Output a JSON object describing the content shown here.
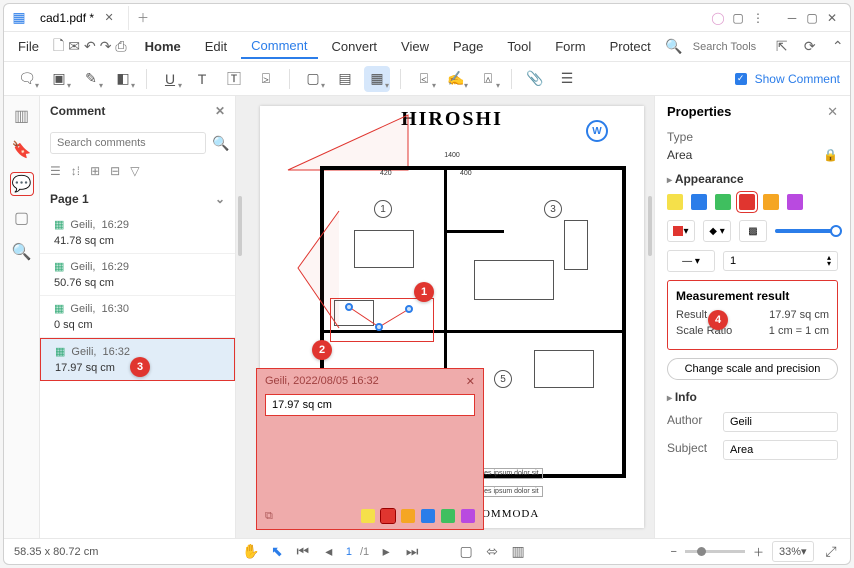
{
  "tab": {
    "title": "cad1.pdf *"
  },
  "menu": {
    "file": "File",
    "home": "Home",
    "edit": "Edit",
    "comment": "Comment",
    "convert": "Convert",
    "view": "View",
    "page": "Page",
    "tool": "Tool",
    "form": "Form",
    "protect": "Protect"
  },
  "search_tools_placeholder": "Search Tools",
  "show_comment": "Show Comment",
  "comment_panel": {
    "title": "Comment",
    "search_placeholder": "Search comments",
    "page_label": "Page 1",
    "items": [
      {
        "author": "Geili,",
        "time": "16:29",
        "value": "41.78 sq cm"
      },
      {
        "author": "Geili,",
        "time": "16:29",
        "value": "50.76 sq cm"
      },
      {
        "author": "Geili,",
        "time": "16:30",
        "value": "0 sq cm"
      },
      {
        "author": "Geili,",
        "time": "16:32",
        "value": "17.97 sq cm"
      }
    ]
  },
  "popup": {
    "meta": "Geili,   2022/08/05 16:32",
    "value": "17.97 sq cm"
  },
  "properties": {
    "title": "Properties",
    "type_label": "Type",
    "type_value": "Area",
    "appearance": "Appearance",
    "opacity_value": "1",
    "measurement_title": "Measurement result",
    "result_label": "Result",
    "result_value": "17.97 sq cm",
    "scale_label": "Scale Ratio",
    "scale_value": "1 cm = 1 cm",
    "change_btn": "Change scale and precision",
    "info": "Info",
    "author_label": "Author",
    "author_value": "Geili",
    "subject_label": "Subject",
    "subject_value": "Area"
  },
  "canvas": {
    "title": "HIROSHI",
    "dim_top": "1400",
    "dim_left_a": "420",
    "dim_left_b": "400",
    "footer": "TAVING IN ACCOMMODA",
    "legend": "Lores ipsum dolor sit"
  },
  "status": {
    "cursor": "58.35 x 80.72 cm",
    "page_cur": "1",
    "page_total": "/1",
    "zoom": "33%"
  },
  "callouts": {
    "c1": "1",
    "c2": "2",
    "c3": "3",
    "c4": "4"
  }
}
